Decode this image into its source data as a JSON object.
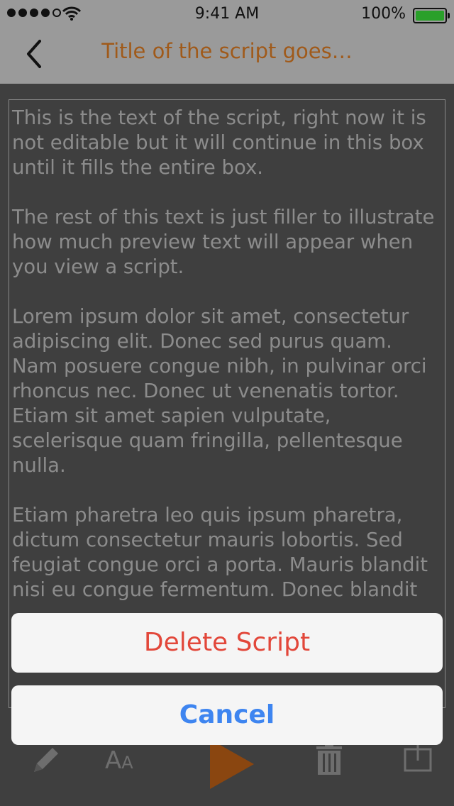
{
  "status_bar": {
    "time": "9:41 AM",
    "battery": "100%"
  },
  "nav": {
    "title": "Title of the script goes…"
  },
  "script": {
    "paragraphs": [
      "This is the text of the script, right now it is not editable but it will continue in this box until it fills the entire box.",
      "The rest of this text is just filler to illustrate how much preview text will appear when you view a script.",
      "Lorem ipsum dolor sit amet, consectetur adipiscing elit. Donec sed purus quam. Nam posuere congue nibh, in pulvinar orci rhoncus nec. Donec ut venenatis tortor. Etiam sit amet sapien vulputate, scelerisque quam fringilla, pellentesque nulla.",
      "Etiam pharetra leo quis ipsum pharetra, dictum consectetur mauris lobortis. Sed feugiat congue orci a porta. Mauris blandit nisi eu congue fermentum. Donec blandit"
    ]
  },
  "toolbar": {
    "font_label": "A",
    "font_label_small": "A"
  },
  "action_sheet": {
    "delete_label": "Delete Script",
    "cancel_label": "Cancel"
  },
  "colors": {
    "accent": "#a05a1a",
    "delete": "#e2473a",
    "cancel": "#3e85f0",
    "play": "#8a4610"
  },
  "icons": [
    "signal-dots-icon",
    "wifi-icon",
    "battery-icon",
    "back-chevron-icon",
    "pencil-icon",
    "font-size-icon",
    "play-icon",
    "trash-icon",
    "share-icon"
  ]
}
